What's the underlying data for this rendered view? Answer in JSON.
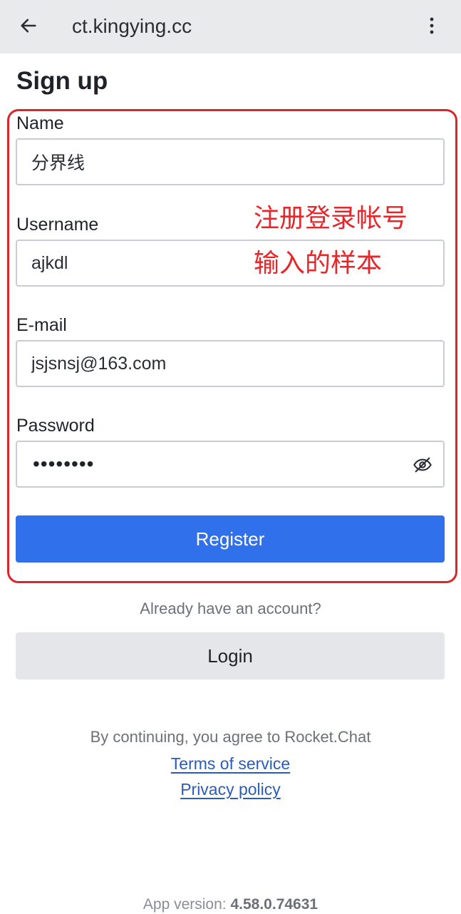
{
  "header": {
    "back_icon": "arrow-left-icon",
    "title": "ct.kingying.cc",
    "menu_icon": "more-vertical-icon"
  },
  "page": {
    "title": "Sign up"
  },
  "form": {
    "name": {
      "label": "Name",
      "value": "分界线"
    },
    "username": {
      "label": "Username",
      "value": "ajkdl"
    },
    "email": {
      "label": "E-mail",
      "value": "jsjsnsj@163.com"
    },
    "password": {
      "label": "Password",
      "masked_value": "••••••••",
      "toggle_icon": "eye-off-icon"
    },
    "register_label": "Register"
  },
  "annotation": {
    "line1": "注册登录帐号",
    "line2": "输入的样本",
    "color": "#e8262a"
  },
  "login_section": {
    "prompt": "Already have an account?",
    "login_label": "Login"
  },
  "legal": {
    "agree_text": "By continuing, you agree to Rocket.Chat",
    "terms_label": "Terms of service",
    "privacy_label": "Privacy policy"
  },
  "footer": {
    "version_prefix": "App version:",
    "version_number": "4.58.0.74631"
  },
  "colors": {
    "accent": "#3170eb",
    "link": "#2a5cb8",
    "highlight": "#d9262c"
  }
}
